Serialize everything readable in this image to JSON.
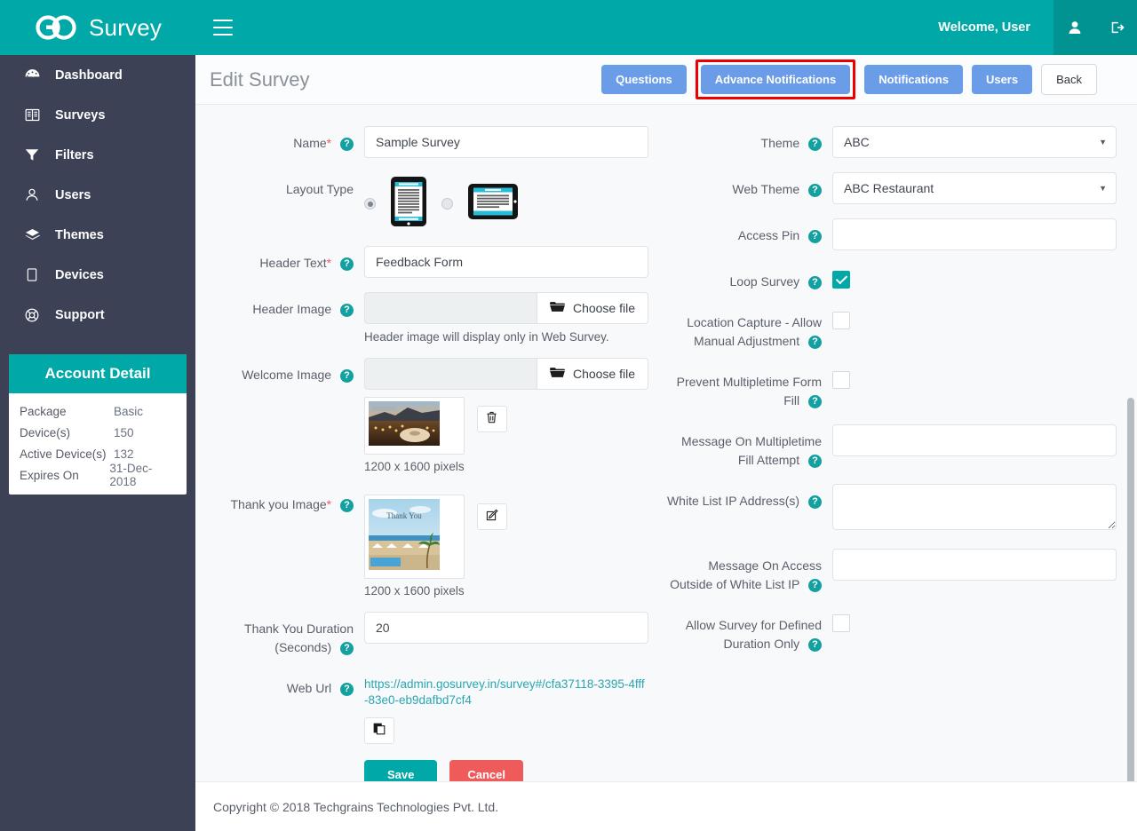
{
  "header": {
    "brand": "Survey",
    "logo_icon": "go-logo-icon",
    "menu_icon": "hamburger-icon",
    "welcome": "Welcome, User",
    "user_icon": "user-icon",
    "logout_icon": "sign-out-icon",
    "brand_color": "#00a9a7"
  },
  "sidebar": {
    "bg_color": "#3c4155",
    "items": [
      {
        "label": "Dashboard",
        "icon": "tachometer-icon"
      },
      {
        "label": "Surveys",
        "icon": "book-icon"
      },
      {
        "label": "Filters",
        "icon": "funnel-icon"
      },
      {
        "label": "Users",
        "icon": "user-icon"
      },
      {
        "label": "Themes",
        "icon": "layers-icon"
      },
      {
        "label": "Devices",
        "icon": "tablet-icon"
      },
      {
        "label": "Support",
        "icon": "life-ring-icon"
      }
    ],
    "account": {
      "title": "Account Detail",
      "rows": [
        {
          "key": "Package",
          "value": "Basic"
        },
        {
          "key": "Device(s)",
          "value": "150"
        },
        {
          "key": "Active Device(s)",
          "value": "132"
        },
        {
          "key": "Expires On",
          "value": "31-Dec-2018"
        }
      ]
    }
  },
  "page": {
    "title": "Edit Survey",
    "buttons": [
      {
        "label": "Questions",
        "style": "primary",
        "highlighted": false
      },
      {
        "label": "Advance Notifications",
        "style": "primary",
        "highlighted": true
      },
      {
        "label": "Notifications",
        "style": "primary",
        "highlighted": false
      },
      {
        "label": "Users",
        "style": "primary",
        "highlighted": false
      },
      {
        "label": "Back",
        "style": "default",
        "highlighted": false
      }
    ],
    "highlight_color": "#ee0000",
    "primary_button_color": "#6a9ce8"
  },
  "form": {
    "left": {
      "name": {
        "label": "Name",
        "required": true,
        "value": "Sample Survey"
      },
      "layout_type": {
        "label": "Layout Type",
        "options": [
          {
            "icon": "phone-portrait-icon",
            "selected": true
          },
          {
            "icon": "tablet-landscape-icon",
            "selected": false
          }
        ]
      },
      "header_text": {
        "label": "Header Text",
        "required": true,
        "value": "Feedback Form"
      },
      "header_image": {
        "label": "Header Image",
        "choose_label": "Choose file",
        "file_name": "",
        "hint": "Header image will display only in Web Survey."
      },
      "welcome_image": {
        "label": "Welcome Image",
        "choose_label": "Choose file",
        "file_name": "",
        "size_note": "1200 x 1600 pixels",
        "action_icon": "trash-icon",
        "thumb_alt": "sunset-dining-photo"
      },
      "thank_you_image": {
        "label": "Thank you Image",
        "required": true,
        "size_note": "1200 x 1600 pixels",
        "action_icon": "edit-icon",
        "thumb_caption": "Thank You",
        "thumb_alt": "beach-resort-photo"
      },
      "thank_you_duration": {
        "label": "Thank You Duration (Seconds)",
        "value": "20"
      },
      "web_url": {
        "label": "Web Url",
        "value": "https://admin.gosurvey.in/survey#/cfa37118-3395-4fff-83e0-eb9dafbd7cf4",
        "copy_icon": "copy-icon"
      },
      "save_label": "Save",
      "cancel_label": "Cancel"
    },
    "right": {
      "theme": {
        "label": "Theme",
        "value": "ABC"
      },
      "web_theme": {
        "label": "Web Theme",
        "value": "ABC Restaurant"
      },
      "access_pin": {
        "label": "Access Pin",
        "value": ""
      },
      "loop_survey": {
        "label": "Loop Survey",
        "checked": true
      },
      "location_capture": {
        "label": "Location Capture - Allow Manual Adjustment",
        "checked": false
      },
      "prevent_multi_fill": {
        "label": "Prevent Multipletime Form Fill",
        "checked": false
      },
      "message_multi_fill": {
        "label": "Message On Multipletime Fill Attempt",
        "value": ""
      },
      "white_list_ip": {
        "label": "White List IP Address(s)",
        "value": ""
      },
      "message_outside_ip": {
        "label": "Message On Access Outside of White List IP",
        "value": ""
      },
      "allow_duration": {
        "label": "Allow Survey for Defined Duration Only",
        "checked": false
      }
    },
    "help_icon": "question-mark-icon"
  },
  "footer": {
    "text": "Copyright © 2018 Techgrains Technologies Pvt. Ltd."
  }
}
